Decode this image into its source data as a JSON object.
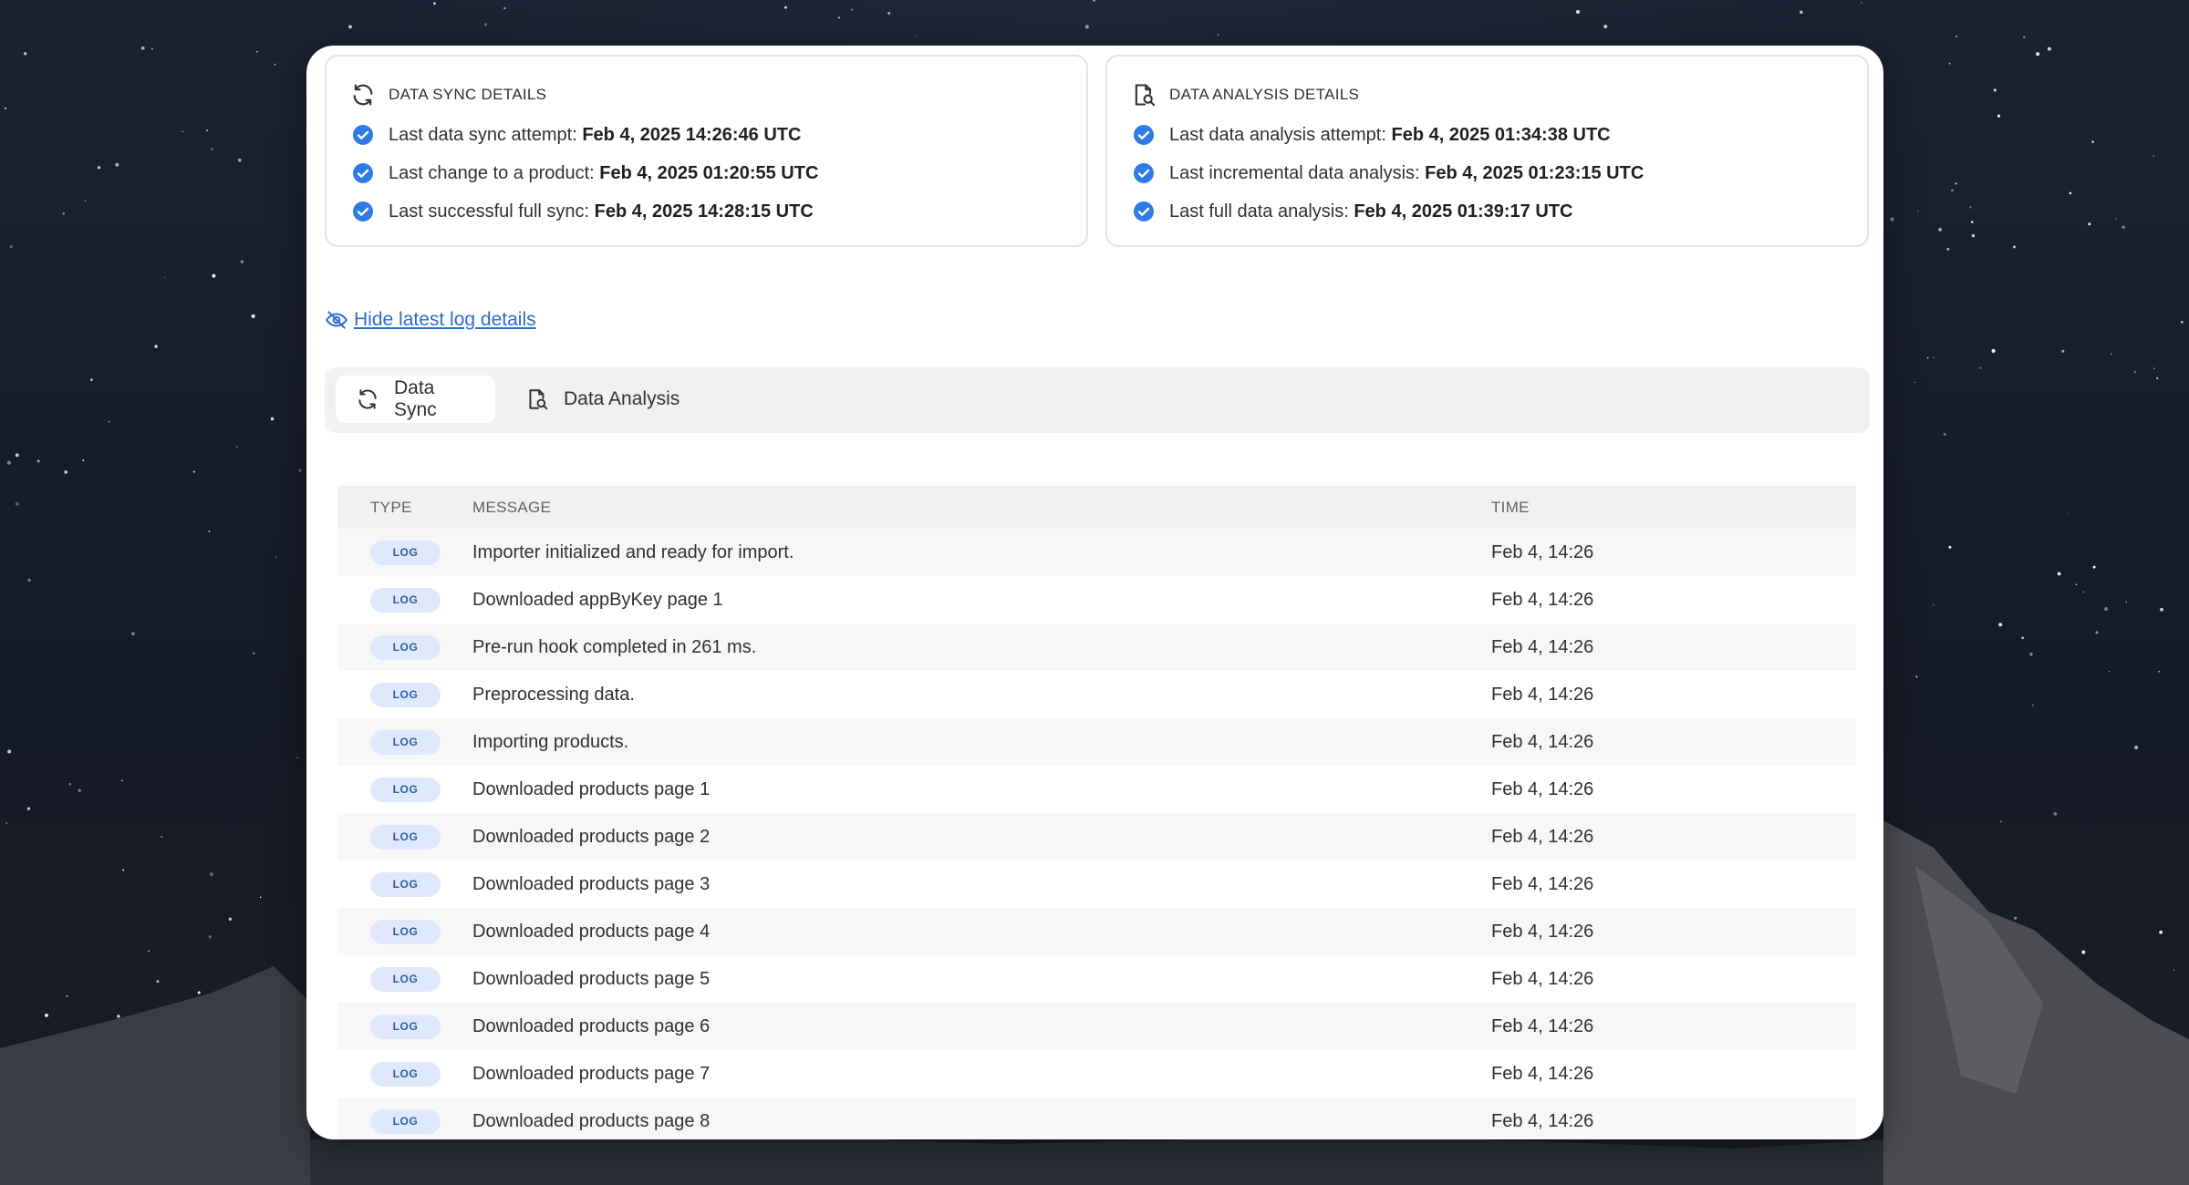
{
  "sync_card": {
    "title": "DATA SYNC DETAILS",
    "icon": "refresh-icon",
    "rows": [
      {
        "label": "Last data sync attempt:",
        "value": "Feb 4, 2025 14:26:46 UTC"
      },
      {
        "label": "Last change to a product:",
        "value": "Feb 4, 2025 01:20:55 UTC"
      },
      {
        "label": "Last successful full sync:",
        "value": "Feb 4, 2025 14:28:15 UTC"
      }
    ]
  },
  "analysis_card": {
    "title": "DATA ANALYSIS DETAILS",
    "icon": "document-search-icon",
    "rows": [
      {
        "label": "Last data analysis attempt:",
        "value": "Feb 4, 2025 01:34:38 UTC"
      },
      {
        "label": "Last incremental data analysis:",
        "value": "Feb 4, 2025 01:23:15 UTC"
      },
      {
        "label": "Last full data analysis:",
        "value": "Feb 4, 2025 01:39:17 UTC"
      }
    ]
  },
  "hide_link": {
    "label": "Hide latest log details",
    "icon": "eye-off-icon"
  },
  "tabs": [
    {
      "label": "Data Sync",
      "icon": "refresh-icon",
      "active": true
    },
    {
      "label": "Data Analysis",
      "icon": "document-search-icon",
      "active": false
    }
  ],
  "log_table": {
    "headers": {
      "type": "TYPE",
      "message": "MESSAGE",
      "time": "TIME"
    },
    "rows": [
      {
        "type": "LOG",
        "message": "Importer initialized and ready for import.",
        "time": "Feb 4, 14:26"
      },
      {
        "type": "LOG",
        "message": "Downloaded appByKey page 1",
        "time": "Feb 4, 14:26"
      },
      {
        "type": "LOG",
        "message": "Pre-run hook completed in 261 ms.",
        "time": "Feb 4, 14:26"
      },
      {
        "type": "LOG",
        "message": "Preprocessing data.",
        "time": "Feb 4, 14:26"
      },
      {
        "type": "LOG",
        "message": "Importing products.",
        "time": "Feb 4, 14:26"
      },
      {
        "type": "LOG",
        "message": "Downloaded products page 1",
        "time": "Feb 4, 14:26"
      },
      {
        "type": "LOG",
        "message": "Downloaded products page 2",
        "time": "Feb 4, 14:26"
      },
      {
        "type": "LOG",
        "message": "Downloaded products page 3",
        "time": "Feb 4, 14:26"
      },
      {
        "type": "LOG",
        "message": "Downloaded products page 4",
        "time": "Feb 4, 14:26"
      },
      {
        "type": "LOG",
        "message": "Downloaded products page 5",
        "time": "Feb 4, 14:26"
      },
      {
        "type": "LOG",
        "message": "Downloaded products page 6",
        "time": "Feb 4, 14:26"
      },
      {
        "type": "LOG",
        "message": "Downloaded products page 7",
        "time": "Feb 4, 14:26"
      },
      {
        "type": "LOG",
        "message": "Downloaded products page 8",
        "time": "Feb 4, 14:26"
      }
    ]
  },
  "colors": {
    "accent": "#2c6ecb",
    "check": "#2f7be5",
    "badge_bg": "#dfe9fb",
    "badge_text": "#2c5aa3"
  }
}
